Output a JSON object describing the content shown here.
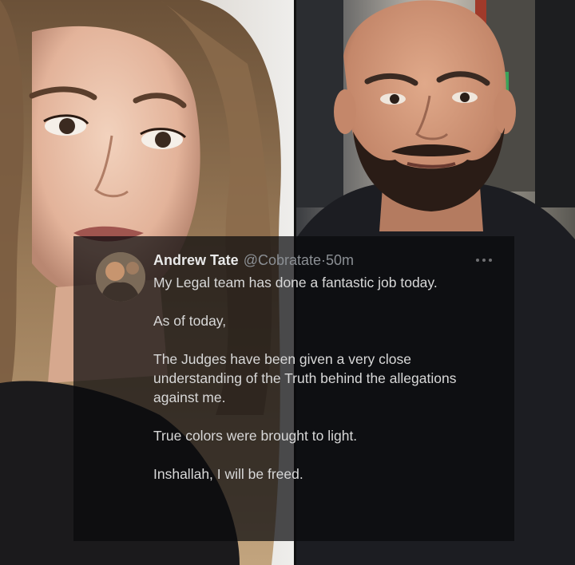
{
  "tweet": {
    "author_name": "Andrew Tate",
    "handle": "@Cobratate",
    "separator": "·",
    "time": "50m",
    "more_icon": "more-horizontal-icon",
    "paragraphs": [
      "My Legal team has done a fantastic job today.",
      "As of today,",
      "The Judges have been given a very close understanding of the Truth behind the allegations against me.",
      "True colors were brought to light.",
      "Inshallah, I will be freed."
    ]
  }
}
